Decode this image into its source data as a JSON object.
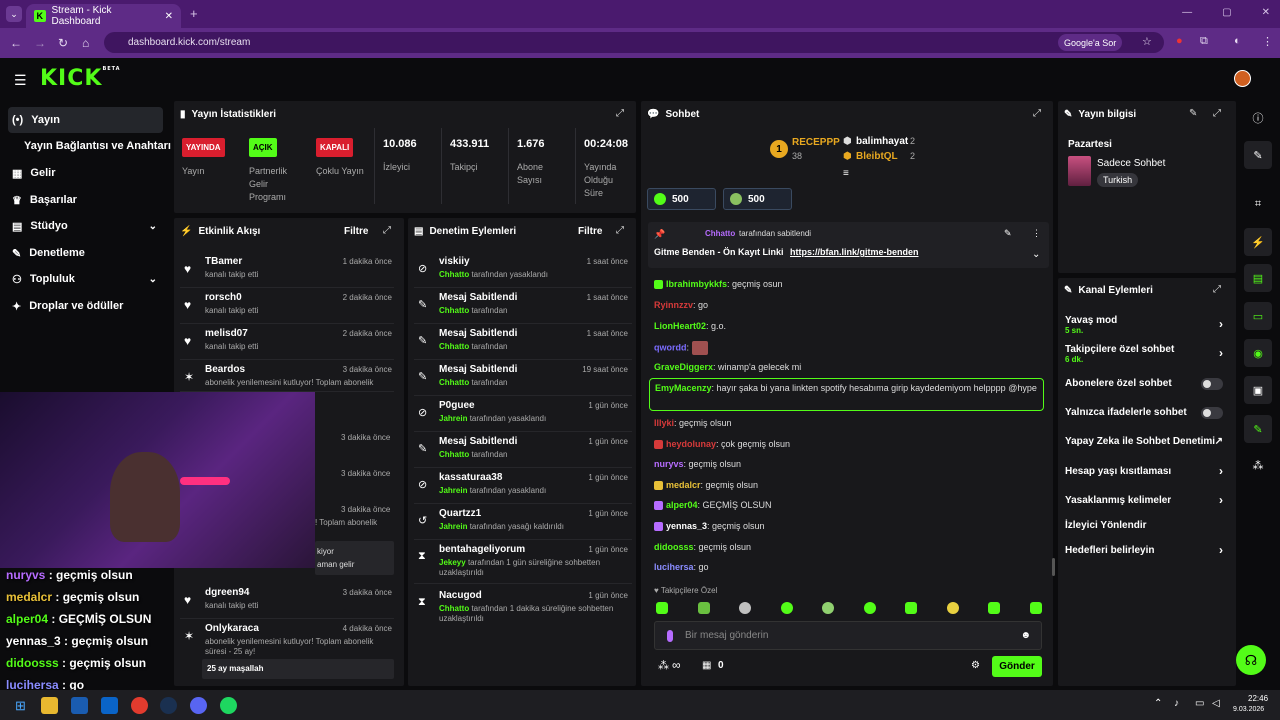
{
  "browser": {
    "tab_title": "Stream - Kick Dashboard",
    "tab_icon_letter": "K",
    "url": "dashboard.kick.com/stream",
    "google_sor": "Google'a Sor"
  },
  "header": {
    "logo": "KICK",
    "logo_sup": "BETA"
  },
  "sidebar": {
    "items": [
      {
        "label": "Yayın",
        "icon": "(•)"
      },
      {
        "label": "Yayın Bağlantısı ve Anahtarı",
        "icon": ""
      },
      {
        "label": "Gelir",
        "icon": "▦"
      },
      {
        "label": "Başarılar",
        "icon": "🏆"
      },
      {
        "label": "Stüdyo",
        "icon": "▤"
      },
      {
        "label": "Denetleme",
        "icon": "🔧"
      },
      {
        "label": "Topluluk",
        "icon": "👥"
      },
      {
        "label": "Droplar ve ödüller",
        "icon": "🎁"
      }
    ]
  },
  "stats": {
    "title": "Yayın İstatistikleri",
    "items": [
      {
        "badge": "YAYINDA",
        "label": "Yayın"
      },
      {
        "badge": "AÇIK",
        "label": "Partnerlik Gelir Programı"
      },
      {
        "badge": "KAPALI",
        "label": "Çoklu Yayın"
      },
      {
        "value": "10.086",
        "label": "İzleyici"
      },
      {
        "value": "433.911",
        "label": "Takipçi"
      },
      {
        "value": "1.676",
        "label": "Abone Sayısı"
      },
      {
        "value": "00:24:08",
        "label": "Yayında Olduğu Süre"
      }
    ]
  },
  "activity": {
    "title": "Etkinlik Akışı",
    "filter": "Filtre",
    "events": [
      {
        "name": "TBamer",
        "sub": "kanalı takip etti",
        "time": "1 dakika önce"
      },
      {
        "name": "rorsch0",
        "sub": "kanalı takip etti",
        "time": "2 dakika önce"
      },
      {
        "name": "melisd07",
        "sub": "kanalı takip etti",
        "time": "2 dakika önce"
      },
      {
        "name": "Beardos",
        "sub": "abonelik yenilemesini kutluyor! Toplam abonelik",
        "time": "3 dakika önce"
      },
      {
        "name": "",
        "sub": "",
        "time": "3 dakika önce"
      },
      {
        "name": "",
        "sub": "",
        "time": "3 dakika önce"
      },
      {
        "name": "",
        "sub": "! Toplam abonelik",
        "time": "3 dakika önce"
      },
      {
        "name": "dgreen94",
        "sub": "kanalı takip etti",
        "time": "3 dakika önce"
      },
      {
        "name": "Onlykaraca",
        "sub": "abonelik yenilemesini kutluyor! Toplam abonelik süresi - 25 ay!",
        "time": "4 dakika önce",
        "extra": "25 ay maşallah"
      }
    ],
    "partial1": "kiyor",
    "partial2": "aman gelir"
  },
  "moderation": {
    "title": "Denetim Eylemleri",
    "filter": "Filtre",
    "items": [
      {
        "name": "viskiiy",
        "by": "Chhatto",
        "sub": "tarafından yasaklandı",
        "time": "1 saat önce",
        "icon": "⊘"
      },
      {
        "name": "Mesaj Sabitlendi",
        "by": "Chhatto",
        "sub": "tarafından",
        "time": "1 saat önce",
        "icon": "📌"
      },
      {
        "name": "Mesaj Sabitlendi",
        "by": "Chhatto",
        "sub": "tarafından",
        "time": "1 saat önce",
        "icon": "📌"
      },
      {
        "name": "Mesaj Sabitlendi",
        "by": "Chhatto",
        "sub": "tarafından",
        "time": "19 saat önce",
        "icon": "📌"
      },
      {
        "name": "P0guee",
        "by": "Jahrein",
        "sub": "tarafından yasaklandı",
        "time": "1 gün önce",
        "icon": "⊘"
      },
      {
        "name": "Mesaj Sabitlendi",
        "by": "Chhatto",
        "sub": "tarafından",
        "time": "1 gün önce",
        "icon": "📌"
      },
      {
        "name": "kassaturaa38",
        "by": "Jahrein",
        "sub": "tarafından yasaklandı",
        "time": "1 gün önce",
        "icon": "⊘"
      },
      {
        "name": "Quartzz1",
        "by": "Jahrein",
        "sub": "tarafından yasağı kaldırıldı",
        "time": "1 gün önce",
        "icon": "↺"
      },
      {
        "name": "bentahageliyorum",
        "by": "Jekeyy",
        "sub": "tarafından 1 gün süreliğine sohbetten uzaklaştırıldı",
        "time": "1 gün önce",
        "icon": "⧗"
      },
      {
        "name": "Nacugod",
        "by": "Chhatto",
        "sub": "tarafından 1 dakika süreliğine sohbetten uzaklaştırıldı",
        "time": "1 gün önce",
        "icon": "⧗"
      }
    ]
  },
  "chat": {
    "title": "Sohbet",
    "top1_name": "RECEPPP",
    "top1_val": "38",
    "top2_name": "balimhayat",
    "top2_val": "2",
    "top3_name": "BleibtQL",
    "top3_val": "2",
    "goal1": "500",
    "goal2": "500",
    "pinned_by": "Chhatto",
    "pinned_suffix": "tarafından sabitlendi",
    "pinned_text": "Gitme Benden - Ön Kayıt Linki",
    "pinned_link": "https://bfan.link/gitme-benden",
    "messages": [
      {
        "user": "Ibrahimbykkfs",
        "color": "#53fc18",
        "text": ": geçmiş osun"
      },
      {
        "user": "Ryinnzzv",
        "color": "#d63a3a",
        "text": ": go"
      },
      {
        "user": "LionHeart02",
        "color": "#53fc18",
        "text": ": g.o."
      },
      {
        "user": "qwordd",
        "color": "#7b6cff",
        "text": ":"
      },
      {
        "user": "GraveDiggerx",
        "color": "#53fc18",
        "text": ": winamp'a gelecek mi"
      },
      {
        "user": "EmyMacenzy",
        "color": "#53fc18",
        "text": ": hayır şaka bi yana linkten spotify hesabıma girip kaydedemiyom helpppp @hype"
      },
      {
        "user": "Illyki",
        "color": "#d63a3a",
        "text": ": geçmiş olsun"
      },
      {
        "user": "heydolunay",
        "color": "#d63a3a",
        "text": ": çok geçmiş olsun"
      },
      {
        "user": "nuryvs",
        "color": "#b66cff",
        "text": ": geçmiş olsun"
      },
      {
        "user": "medalcr",
        "color": "#e8c038",
        "text": ": geçmiş olsun"
      },
      {
        "user": "alper04",
        "color": "#53fc18",
        "text": ": GEÇMİŞ OLSUN"
      },
      {
        "user": "yennas_3",
        "color": "#ffffff",
        "text": ": geçmiş olsun"
      },
      {
        "user": "didoosss",
        "color": "#53fc18",
        "text": ": geçmiş olsun"
      },
      {
        "user": "lucihersa",
        "color": "#8a8cff",
        "text": ": go"
      }
    ],
    "followers_only": "Takipçilere Özel",
    "input_placeholder": "Bir mesaj gönderin",
    "points": "0",
    "send": "Gönder",
    "infinity": "∞"
  },
  "stream_info": {
    "title": "Yayın bilgisi",
    "day": "Pazartesi",
    "name": "Sadece Sohbet",
    "tag": "Turkish"
  },
  "channel_actions": {
    "title": "Kanal Eylemleri",
    "items": [
      {
        "label": "Yavaş mod",
        "sub": "5 sn.",
        "type": "chev"
      },
      {
        "label": "Takipçilere özel sohbet",
        "sub": "6 dk.",
        "type": "chev"
      },
      {
        "label": "Abonelere özel sohbet",
        "sub": "",
        "type": "toggle"
      },
      {
        "label": "Yalnızca ifadelerle sohbet",
        "sub": "",
        "type": "toggle"
      },
      {
        "label": "Yapay Zeka ile Sohbet Denetimi",
        "sub": "",
        "type": "ext"
      },
      {
        "label": "Hesap yaşı kısıtlaması",
        "sub": "",
        "type": "chev"
      },
      {
        "label": "Yasaklanmış kelimeler",
        "sub": "",
        "type": "chev"
      },
      {
        "label": "İzleyici Yönlendir",
        "sub": "",
        "type": "none"
      },
      {
        "label": "Hedefleri belirleyin",
        "sub": "",
        "type": "chev"
      }
    ]
  },
  "overlay": {
    "lines": [
      {
        "user": "nuryvs",
        "color": "#b66cff",
        "text": " : geçmiş olsun"
      },
      {
        "user": "medalcr",
        "color": "#e8c038",
        "text": " : geçmiş olsun"
      },
      {
        "user": "alper04",
        "color": "#53fc18",
        "text": " : GEÇMİŞ OLSUN"
      },
      {
        "user": "yennas_3",
        "color": "#ffffff",
        "text": " : geçmiş olsun"
      },
      {
        "user": "didoosss",
        "color": "#53fc18",
        "text": " : geçmiş olsun"
      },
      {
        "user": "lucihersa",
        "color": "#8a8cff",
        "text": " : go"
      }
    ]
  },
  "taskbar": {
    "time": "22:46",
    "date": "9.03.2026"
  }
}
